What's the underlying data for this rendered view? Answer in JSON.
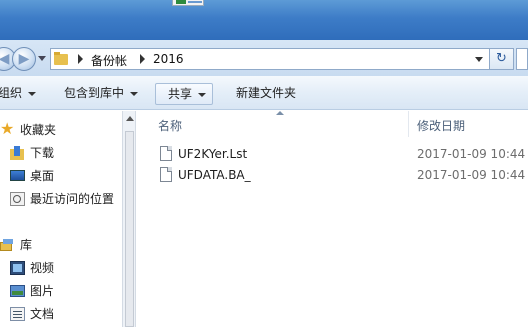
{
  "address": {
    "crumbs": [
      "备份帐",
      "2016"
    ]
  },
  "toolbar": {
    "organize": "组织",
    "include_in_library": "包含到库中",
    "share": "共享",
    "new_folder": "新建文件夹"
  },
  "nav": {
    "favorites": "收藏夹",
    "downloads": "下载",
    "desktop": "桌面",
    "recent": "最近访问的位置",
    "libraries": "库",
    "videos": "视频",
    "pictures": "图片",
    "documents": "文档"
  },
  "columns": {
    "name": "名称",
    "modified": "修改日期"
  },
  "files": [
    {
      "name": "UF2KYer.Lst",
      "modified": "2017-01-09 10:44"
    },
    {
      "name": "UFDATA.BA_",
      "modified": "2017-01-09 10:44"
    }
  ]
}
